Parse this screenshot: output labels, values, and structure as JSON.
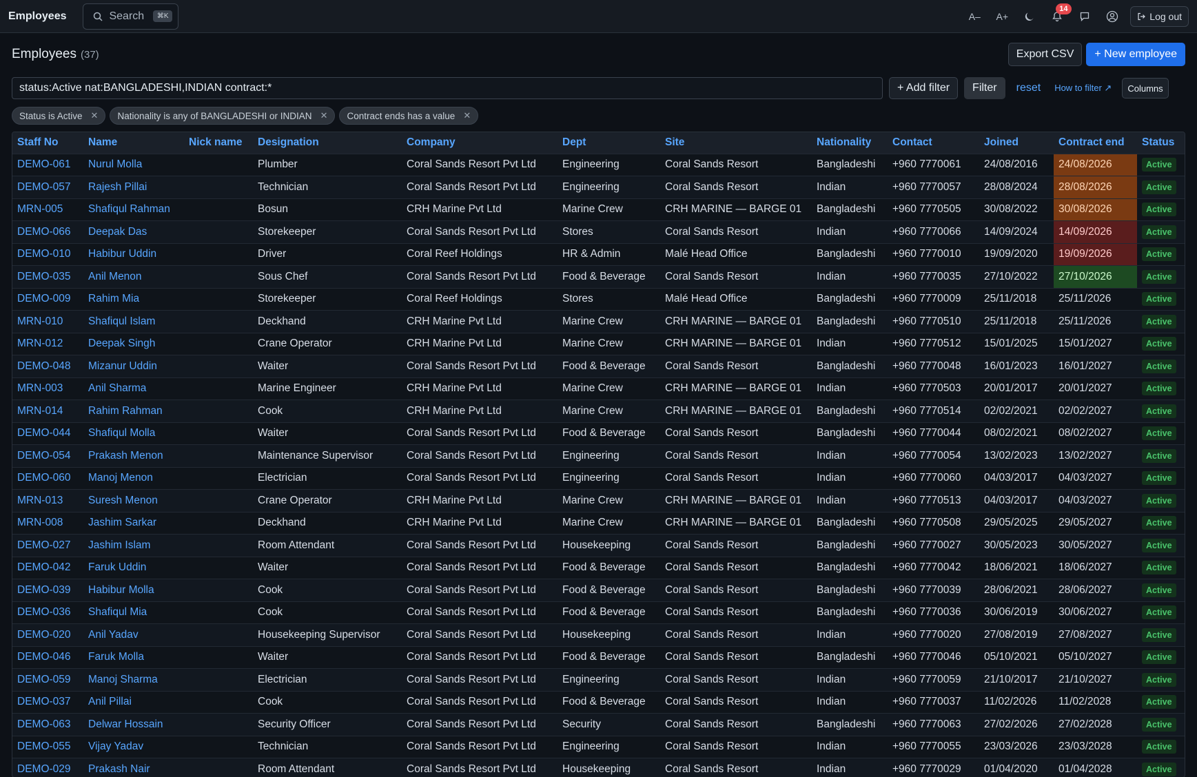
{
  "topbar": {
    "title": "Employees",
    "search_label": "Search",
    "search_shortcut": "⌘K",
    "font_decrease": "A–",
    "font_increase": "A+",
    "notification_count": "14",
    "logout_label": "Log out"
  },
  "header": {
    "title": "Employees",
    "count": "(37)",
    "export_label": "Export CSV",
    "new_label": "+ New employee"
  },
  "filter": {
    "query": "status:Active nat:BANGLADESHI,INDIAN contract:*",
    "add_filter_label": "+ Add filter",
    "filter_label": "Filter",
    "reset_label": "reset",
    "how_label": "How to filter ↗",
    "columns_label": "Columns"
  },
  "chips": [
    {
      "label": "Status is Active"
    },
    {
      "label": "Nationality is any of BANGLADESHI or INDIAN"
    },
    {
      "label": "Contract ends has a value"
    }
  ],
  "colors": {
    "accent": "#58a6ff",
    "primary_button": "#1f6feb",
    "contract_urgent": "#7a3a12",
    "contract_soon": "#5a1d1d",
    "contract_later": "#1d4a22",
    "status_active": "#4ac26b"
  },
  "table": {
    "headers": [
      "Staff No",
      "Name",
      "Nick name",
      "Designation",
      "Company",
      "Dept",
      "Site",
      "Nationality",
      "Contact",
      "Joined",
      "Contract end",
      "Status"
    ],
    "rows": [
      {
        "staff_no": "DEMO-061",
        "name": "Nurul Molla",
        "nick": "",
        "designation": "Plumber",
        "company": "Coral Sands Resort Pvt Ltd",
        "dept": "Engineering",
        "site": "Coral Sands Resort",
        "nationality": "Bangladeshi",
        "contact": "+960 7770061",
        "joined": "24/08/2016",
        "contract_end": "24/08/2026",
        "contract_flag": "orange",
        "status": "Active"
      },
      {
        "staff_no": "DEMO-057",
        "name": "Rajesh Pillai",
        "nick": "",
        "designation": "Technician",
        "company": "Coral Sands Resort Pvt Ltd",
        "dept": "Engineering",
        "site": "Coral Sands Resort",
        "nationality": "Indian",
        "contact": "+960 7770057",
        "joined": "28/08/2024",
        "contract_end": "28/08/2026",
        "contract_flag": "orange",
        "status": "Active"
      },
      {
        "staff_no": "MRN-005",
        "name": "Shafiqul Rahman",
        "nick": "",
        "designation": "Bosun",
        "company": "CRH Marine Pvt Ltd",
        "dept": "Marine Crew",
        "site": "CRH MARINE — BARGE 01",
        "nationality": "Bangladeshi",
        "contact": "+960 7770505",
        "joined": "30/08/2022",
        "contract_end": "30/08/2026",
        "contract_flag": "orange",
        "status": "Active"
      },
      {
        "staff_no": "DEMO-066",
        "name": "Deepak Das",
        "nick": "",
        "designation": "Storekeeper",
        "company": "Coral Sands Resort Pvt Ltd",
        "dept": "Stores",
        "site": "Coral Sands Resort",
        "nationality": "Indian",
        "contact": "+960 7770066",
        "joined": "14/09/2024",
        "contract_end": "14/09/2026",
        "contract_flag": "red",
        "status": "Active"
      },
      {
        "staff_no": "DEMO-010",
        "name": "Habibur Uddin",
        "nick": "",
        "designation": "Driver",
        "company": "Coral Reef Holdings",
        "dept": "HR & Admin",
        "site": "Malé Head Office",
        "nationality": "Bangladeshi",
        "contact": "+960 7770010",
        "joined": "19/09/2020",
        "contract_end": "19/09/2026",
        "contract_flag": "red",
        "status": "Active"
      },
      {
        "staff_no": "DEMO-035",
        "name": "Anil Menon",
        "nick": "",
        "designation": "Sous Chef",
        "company": "Coral Sands Resort Pvt Ltd",
        "dept": "Food & Beverage",
        "site": "Coral Sands Resort",
        "nationality": "Indian",
        "contact": "+960 7770035",
        "joined": "27/10/2022",
        "contract_end": "27/10/2026",
        "contract_flag": "green",
        "status": "Active"
      },
      {
        "staff_no": "DEMO-009",
        "name": "Rahim Mia",
        "nick": "",
        "designation": "Storekeeper",
        "company": "Coral Reef Holdings",
        "dept": "Stores",
        "site": "Malé Head Office",
        "nationality": "Bangladeshi",
        "contact": "+960 7770009",
        "joined": "25/11/2018",
        "contract_end": "25/11/2026",
        "contract_flag": "",
        "status": "Active"
      },
      {
        "staff_no": "MRN-010",
        "name": "Shafiqul Islam",
        "nick": "",
        "designation": "Deckhand",
        "company": "CRH Marine Pvt Ltd",
        "dept": "Marine Crew",
        "site": "CRH MARINE — BARGE 01",
        "nationality": "Bangladeshi",
        "contact": "+960 7770510",
        "joined": "25/11/2018",
        "contract_end": "25/11/2026",
        "contract_flag": "",
        "status": "Active"
      },
      {
        "staff_no": "MRN-012",
        "name": "Deepak Singh",
        "nick": "",
        "designation": "Crane Operator",
        "company": "CRH Marine Pvt Ltd",
        "dept": "Marine Crew",
        "site": "CRH MARINE — BARGE 01",
        "nationality": "Indian",
        "contact": "+960 7770512",
        "joined": "15/01/2025",
        "contract_end": "15/01/2027",
        "contract_flag": "",
        "status": "Active"
      },
      {
        "staff_no": "DEMO-048",
        "name": "Mizanur Uddin",
        "nick": "",
        "designation": "Waiter",
        "company": "Coral Sands Resort Pvt Ltd",
        "dept": "Food & Beverage",
        "site": "Coral Sands Resort",
        "nationality": "Bangladeshi",
        "contact": "+960 7770048",
        "joined": "16/01/2023",
        "contract_end": "16/01/2027",
        "contract_flag": "",
        "status": "Active"
      },
      {
        "staff_no": "MRN-003",
        "name": "Anil Sharma",
        "nick": "",
        "designation": "Marine Engineer",
        "company": "CRH Marine Pvt Ltd",
        "dept": "Marine Crew",
        "site": "CRH MARINE — BARGE 01",
        "nationality": "Indian",
        "contact": "+960 7770503",
        "joined": "20/01/2017",
        "contract_end": "20/01/2027",
        "contract_flag": "",
        "status": "Active"
      },
      {
        "staff_no": "MRN-014",
        "name": "Rahim Rahman",
        "nick": "",
        "designation": "Cook",
        "company": "CRH Marine Pvt Ltd",
        "dept": "Marine Crew",
        "site": "CRH MARINE — BARGE 01",
        "nationality": "Bangladeshi",
        "contact": "+960 7770514",
        "joined": "02/02/2021",
        "contract_end": "02/02/2027",
        "contract_flag": "",
        "status": "Active"
      },
      {
        "staff_no": "DEMO-044",
        "name": "Shafiqul Molla",
        "nick": "",
        "designation": "Waiter",
        "company": "Coral Sands Resort Pvt Ltd",
        "dept": "Food & Beverage",
        "site": "Coral Sands Resort",
        "nationality": "Bangladeshi",
        "contact": "+960 7770044",
        "joined": "08/02/2021",
        "contract_end": "08/02/2027",
        "contract_flag": "",
        "status": "Active"
      },
      {
        "staff_no": "DEMO-054",
        "name": "Prakash Menon",
        "nick": "",
        "designation": "Maintenance Supervisor",
        "company": "Coral Sands Resort Pvt Ltd",
        "dept": "Engineering",
        "site": "Coral Sands Resort",
        "nationality": "Indian",
        "contact": "+960 7770054",
        "joined": "13/02/2023",
        "contract_end": "13/02/2027",
        "contract_flag": "",
        "status": "Active"
      },
      {
        "staff_no": "DEMO-060",
        "name": "Manoj Menon",
        "nick": "",
        "designation": "Electrician",
        "company": "Coral Sands Resort Pvt Ltd",
        "dept": "Engineering",
        "site": "Coral Sands Resort",
        "nationality": "Indian",
        "contact": "+960 7770060",
        "joined": "04/03/2017",
        "contract_end": "04/03/2027",
        "contract_flag": "",
        "status": "Active"
      },
      {
        "staff_no": "MRN-013",
        "name": "Suresh Menon",
        "nick": "",
        "designation": "Crane Operator",
        "company": "CRH Marine Pvt Ltd",
        "dept": "Marine Crew",
        "site": "CRH MARINE — BARGE 01",
        "nationality": "Indian",
        "contact": "+960 7770513",
        "joined": "04/03/2017",
        "contract_end": "04/03/2027",
        "contract_flag": "",
        "status": "Active"
      },
      {
        "staff_no": "MRN-008",
        "name": "Jashim Sarkar",
        "nick": "",
        "designation": "Deckhand",
        "company": "CRH Marine Pvt Ltd",
        "dept": "Marine Crew",
        "site": "CRH MARINE — BARGE 01",
        "nationality": "Bangladeshi",
        "contact": "+960 7770508",
        "joined": "29/05/2025",
        "contract_end": "29/05/2027",
        "contract_flag": "",
        "status": "Active"
      },
      {
        "staff_no": "DEMO-027",
        "name": "Jashim Islam",
        "nick": "",
        "designation": "Room Attendant",
        "company": "Coral Sands Resort Pvt Ltd",
        "dept": "Housekeeping",
        "site": "Coral Sands Resort",
        "nationality": "Bangladeshi",
        "contact": "+960 7770027",
        "joined": "30/05/2023",
        "contract_end": "30/05/2027",
        "contract_flag": "",
        "status": "Active"
      },
      {
        "staff_no": "DEMO-042",
        "name": "Faruk Uddin",
        "nick": "",
        "designation": "Waiter",
        "company": "Coral Sands Resort Pvt Ltd",
        "dept": "Food & Beverage",
        "site": "Coral Sands Resort",
        "nationality": "Bangladeshi",
        "contact": "+960 7770042",
        "joined": "18/06/2021",
        "contract_end": "18/06/2027",
        "contract_flag": "",
        "status": "Active"
      },
      {
        "staff_no": "DEMO-039",
        "name": "Habibur Molla",
        "nick": "",
        "designation": "Cook",
        "company": "Coral Sands Resort Pvt Ltd",
        "dept": "Food & Beverage",
        "site": "Coral Sands Resort",
        "nationality": "Bangladeshi",
        "contact": "+960 7770039",
        "joined": "28/06/2021",
        "contract_end": "28/06/2027",
        "contract_flag": "",
        "status": "Active"
      },
      {
        "staff_no": "DEMO-036",
        "name": "Shafiqul Mia",
        "nick": "",
        "designation": "Cook",
        "company": "Coral Sands Resort Pvt Ltd",
        "dept": "Food & Beverage",
        "site": "Coral Sands Resort",
        "nationality": "Bangladeshi",
        "contact": "+960 7770036",
        "joined": "30/06/2019",
        "contract_end": "30/06/2027",
        "contract_flag": "",
        "status": "Active"
      },
      {
        "staff_no": "DEMO-020",
        "name": "Anil Yadav",
        "nick": "",
        "designation": "Housekeeping Supervisor",
        "company": "Coral Sands Resort Pvt Ltd",
        "dept": "Housekeeping",
        "site": "Coral Sands Resort",
        "nationality": "Indian",
        "contact": "+960 7770020",
        "joined": "27/08/2019",
        "contract_end": "27/08/2027",
        "contract_flag": "",
        "status": "Active"
      },
      {
        "staff_no": "DEMO-046",
        "name": "Faruk Molla",
        "nick": "",
        "designation": "Waiter",
        "company": "Coral Sands Resort Pvt Ltd",
        "dept": "Food & Beverage",
        "site": "Coral Sands Resort",
        "nationality": "Bangladeshi",
        "contact": "+960 7770046",
        "joined": "05/10/2021",
        "contract_end": "05/10/2027",
        "contract_flag": "",
        "status": "Active"
      },
      {
        "staff_no": "DEMO-059",
        "name": "Manoj Sharma",
        "nick": "",
        "designation": "Electrician",
        "company": "Coral Sands Resort Pvt Ltd",
        "dept": "Engineering",
        "site": "Coral Sands Resort",
        "nationality": "Indian",
        "contact": "+960 7770059",
        "joined": "21/10/2017",
        "contract_end": "21/10/2027",
        "contract_flag": "",
        "status": "Active"
      },
      {
        "staff_no": "DEMO-037",
        "name": "Anil Pillai",
        "nick": "",
        "designation": "Cook",
        "company": "Coral Sands Resort Pvt Ltd",
        "dept": "Food & Beverage",
        "site": "Coral Sands Resort",
        "nationality": "Indian",
        "contact": "+960 7770037",
        "joined": "11/02/2026",
        "contract_end": "11/02/2028",
        "contract_flag": "",
        "status": "Active"
      },
      {
        "staff_no": "DEMO-063",
        "name": "Delwar Hossain",
        "nick": "",
        "designation": "Security Officer",
        "company": "Coral Sands Resort Pvt Ltd",
        "dept": "Security",
        "site": "Coral Sands Resort",
        "nationality": "Bangladeshi",
        "contact": "+960 7770063",
        "joined": "27/02/2026",
        "contract_end": "27/02/2028",
        "contract_flag": "",
        "status": "Active"
      },
      {
        "staff_no": "DEMO-055",
        "name": "Vijay Yadav",
        "nick": "",
        "designation": "Technician",
        "company": "Coral Sands Resort Pvt Ltd",
        "dept": "Engineering",
        "site": "Coral Sands Resort",
        "nationality": "Indian",
        "contact": "+960 7770055",
        "joined": "23/03/2026",
        "contract_end": "23/03/2028",
        "contract_flag": "",
        "status": "Active"
      },
      {
        "staff_no": "DEMO-029",
        "name": "Prakash Nair",
        "nick": "",
        "designation": "Room Attendant",
        "company": "Coral Sands Resort Pvt Ltd",
        "dept": "Housekeeping",
        "site": "Coral Sands Resort",
        "nationality": "Indian",
        "contact": "+960 7770029",
        "joined": "01/04/2020",
        "contract_end": "01/04/2028",
        "contract_flag": "",
        "status": "Active"
      }
    ]
  }
}
